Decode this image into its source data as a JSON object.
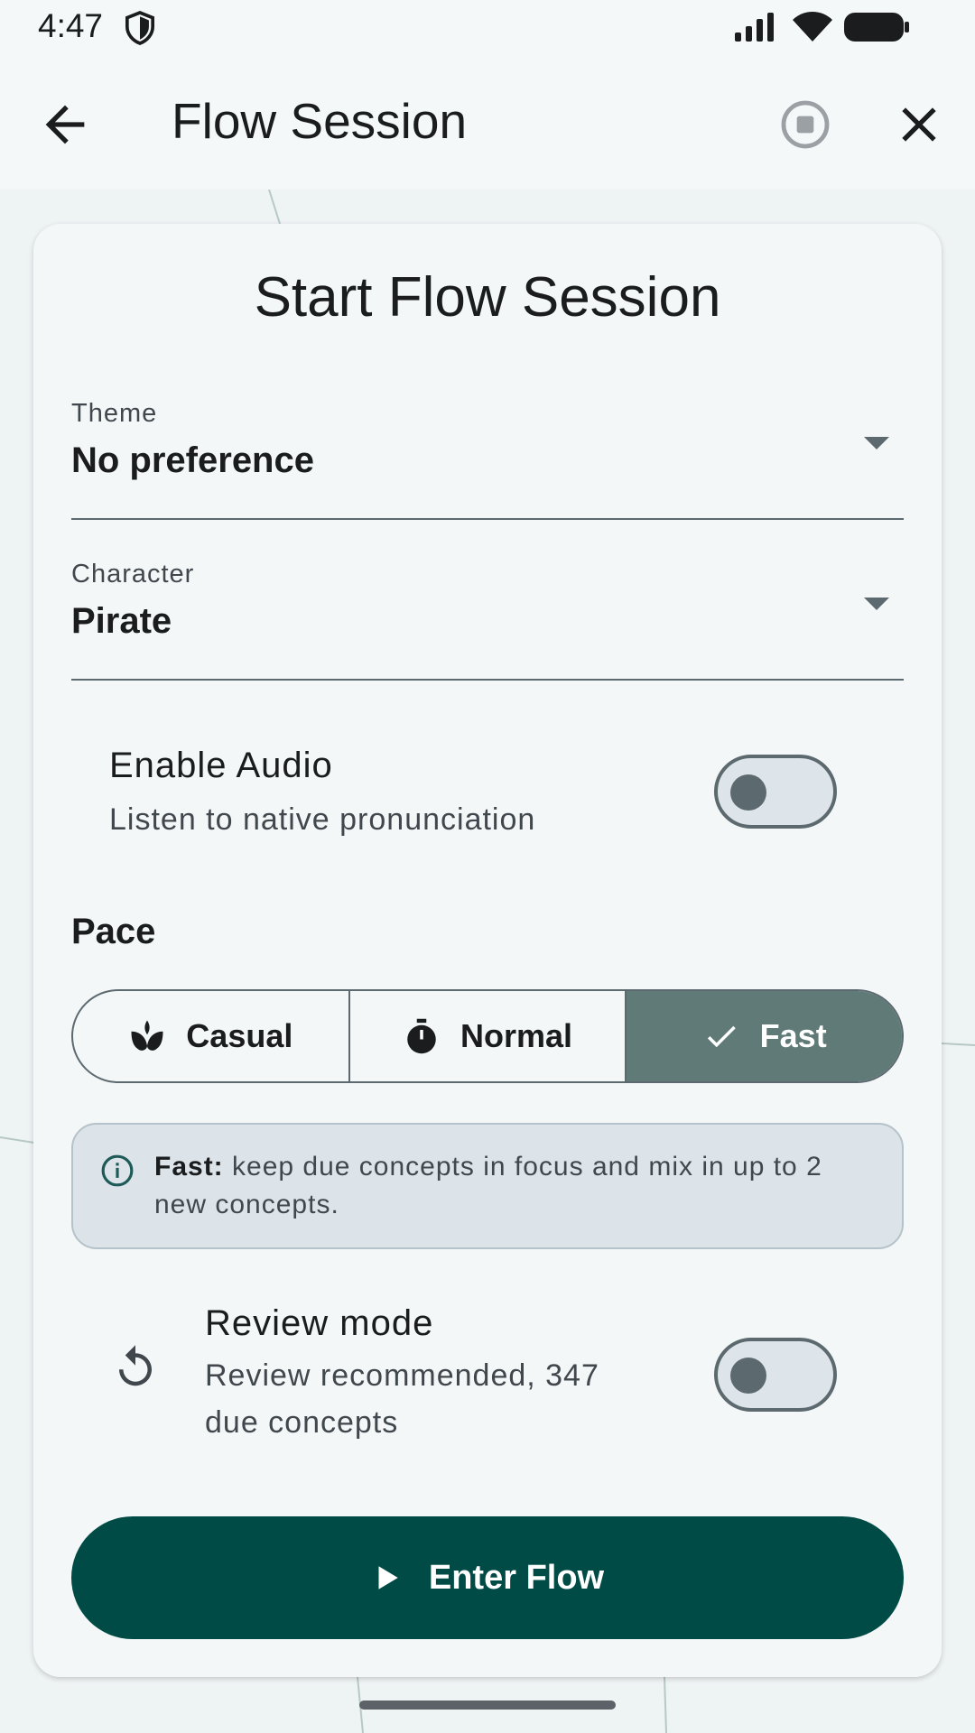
{
  "status_bar": {
    "time": "4:47",
    "icons": [
      "shield-icon",
      "signal-icon",
      "wifi-icon",
      "battery-icon"
    ]
  },
  "app_bar": {
    "title": "Flow Session",
    "icons": [
      "back-arrow-icon",
      "stop-icon",
      "close-icon"
    ]
  },
  "card": {
    "title": "Start Flow Session",
    "theme": {
      "label": "Theme",
      "value": "No preference"
    },
    "character": {
      "label": "Character",
      "value": "Pirate"
    },
    "audio": {
      "title": "Enable Audio",
      "subtitle": "Listen to native pronunciation",
      "enabled": false
    },
    "pace": {
      "label": "Pace",
      "options": [
        {
          "label": "Casual",
          "icon": "sprout-icon",
          "selected": false
        },
        {
          "label": "Normal",
          "icon": "timer-icon",
          "selected": false
        },
        {
          "label": "Fast",
          "icon": "check-icon",
          "selected": true
        }
      ]
    },
    "info": {
      "bold": "Fast:",
      "text": "keep due concepts in focus and mix in up to 2 new concepts."
    },
    "review": {
      "title": "Review mode",
      "subtitle": "Review recommended, 347 due concepts",
      "enabled": false
    },
    "enter_button": "Enter Flow"
  },
  "colors": {
    "primary": "#004b45",
    "selected_segment": "#5f7a77",
    "outline": "#5c6a70",
    "background": "#eef3f4"
  }
}
